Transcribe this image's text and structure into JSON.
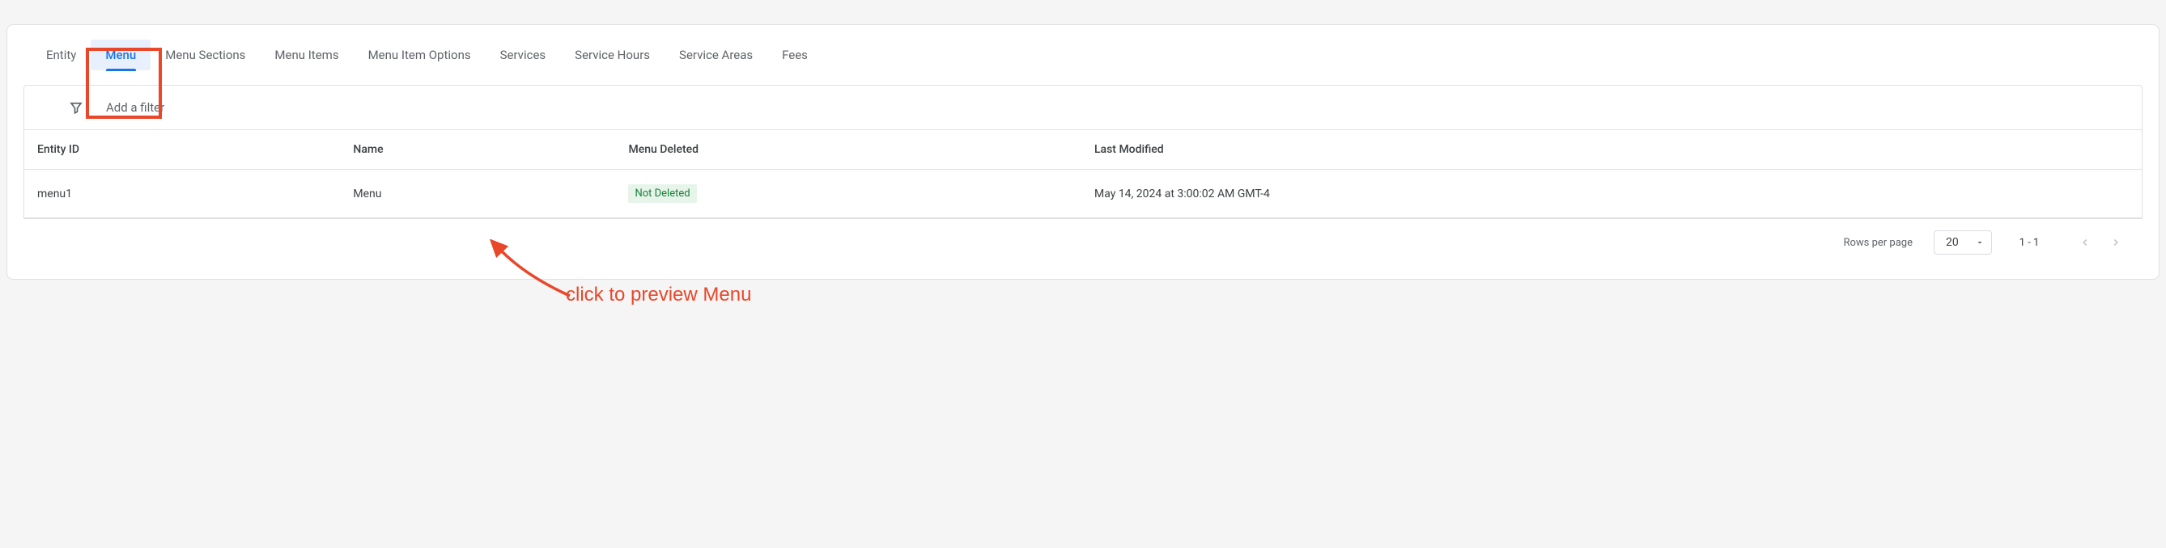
{
  "tabs": [
    {
      "label": "Entity"
    },
    {
      "label": "Menu"
    },
    {
      "label": "Menu Sections"
    },
    {
      "label": "Menu Items"
    },
    {
      "label": "Menu Item Options"
    },
    {
      "label": "Services"
    },
    {
      "label": "Service Hours"
    },
    {
      "label": "Service Areas"
    },
    {
      "label": "Fees"
    }
  ],
  "active_tab_index": 1,
  "filter": {
    "placeholder": "Add a filter"
  },
  "columns": {
    "entity_id": "Entity ID",
    "name": "Name",
    "menu_deleted": "Menu Deleted",
    "last_modified": "Last Modified"
  },
  "rows": [
    {
      "entity_id": "menu1",
      "name": "Menu",
      "menu_deleted": "Not Deleted",
      "last_modified": "May 14, 2024 at 3:00:02 AM GMT-4"
    }
  ],
  "pagination": {
    "rows_per_page_label": "Rows per page",
    "rows_per_page_value": "20",
    "range": "1 - 1"
  },
  "annotation": {
    "text": "click to preview Menu"
  },
  "colors": {
    "accent": "#1a73e8",
    "highlight": "#e8472a",
    "badge_bg": "#e6f4ea",
    "badge_fg": "#188038"
  }
}
